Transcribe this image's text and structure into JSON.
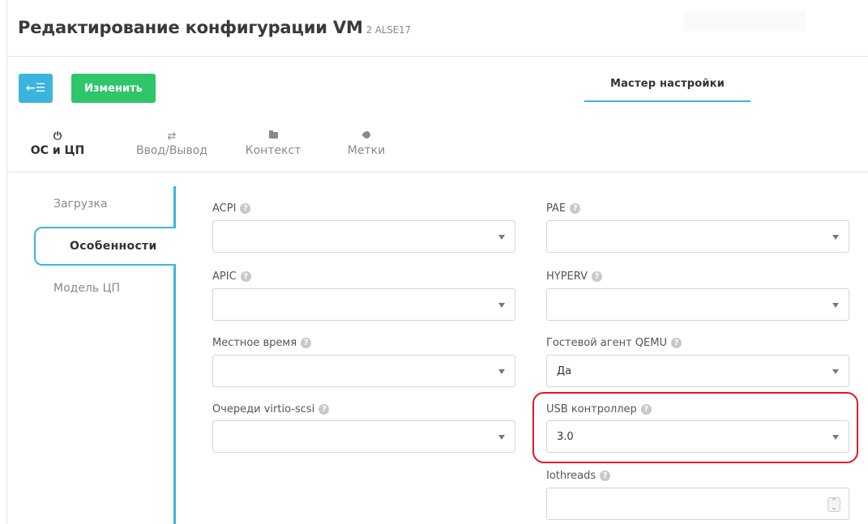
{
  "header": {
    "title": "Редактирование конфигурации VM",
    "subtitle": "2 ALSE17"
  },
  "toolbar": {
    "back_label": "←☰",
    "edit_label": "Изменить",
    "wizard_label": "Мастер настройки"
  },
  "tabs": [
    {
      "label": "ОС и ЦП",
      "icon": "power-icon",
      "glyph": "⏻"
    },
    {
      "label": "Ввод/Вывод",
      "icon": "swap-icon",
      "glyph": "⇄"
    },
    {
      "label": "Контекст",
      "icon": "folder-icon"
    },
    {
      "label": "Метки",
      "icon": "tag-icon"
    }
  ],
  "sidebar": {
    "items": [
      {
        "label": "Загрузка"
      },
      {
        "label": "Особенности"
      },
      {
        "label": "Модель ЦП"
      }
    ]
  },
  "fields": {
    "acpi": {
      "label": "ACPI",
      "value": ""
    },
    "pae": {
      "label": "PAE",
      "value": ""
    },
    "apic": {
      "label": "APIC",
      "value": ""
    },
    "hyperv": {
      "label": "HYPERV",
      "value": ""
    },
    "localtime": {
      "label": "Местное время",
      "value": ""
    },
    "qemu_agent": {
      "label": "Гостевой агент QEMU",
      "value": "Да"
    },
    "virtio_scsi": {
      "label": "Очереди virtio-scsi",
      "value": ""
    },
    "usb": {
      "label": "USB контроллер",
      "value": "3.0"
    },
    "iothreads": {
      "label": "Iothreads",
      "value": ""
    }
  },
  "help_glyph": "?",
  "colors": {
    "accent": "#3bb5de",
    "success": "#2ec56b",
    "highlight": "#e8142a"
  }
}
